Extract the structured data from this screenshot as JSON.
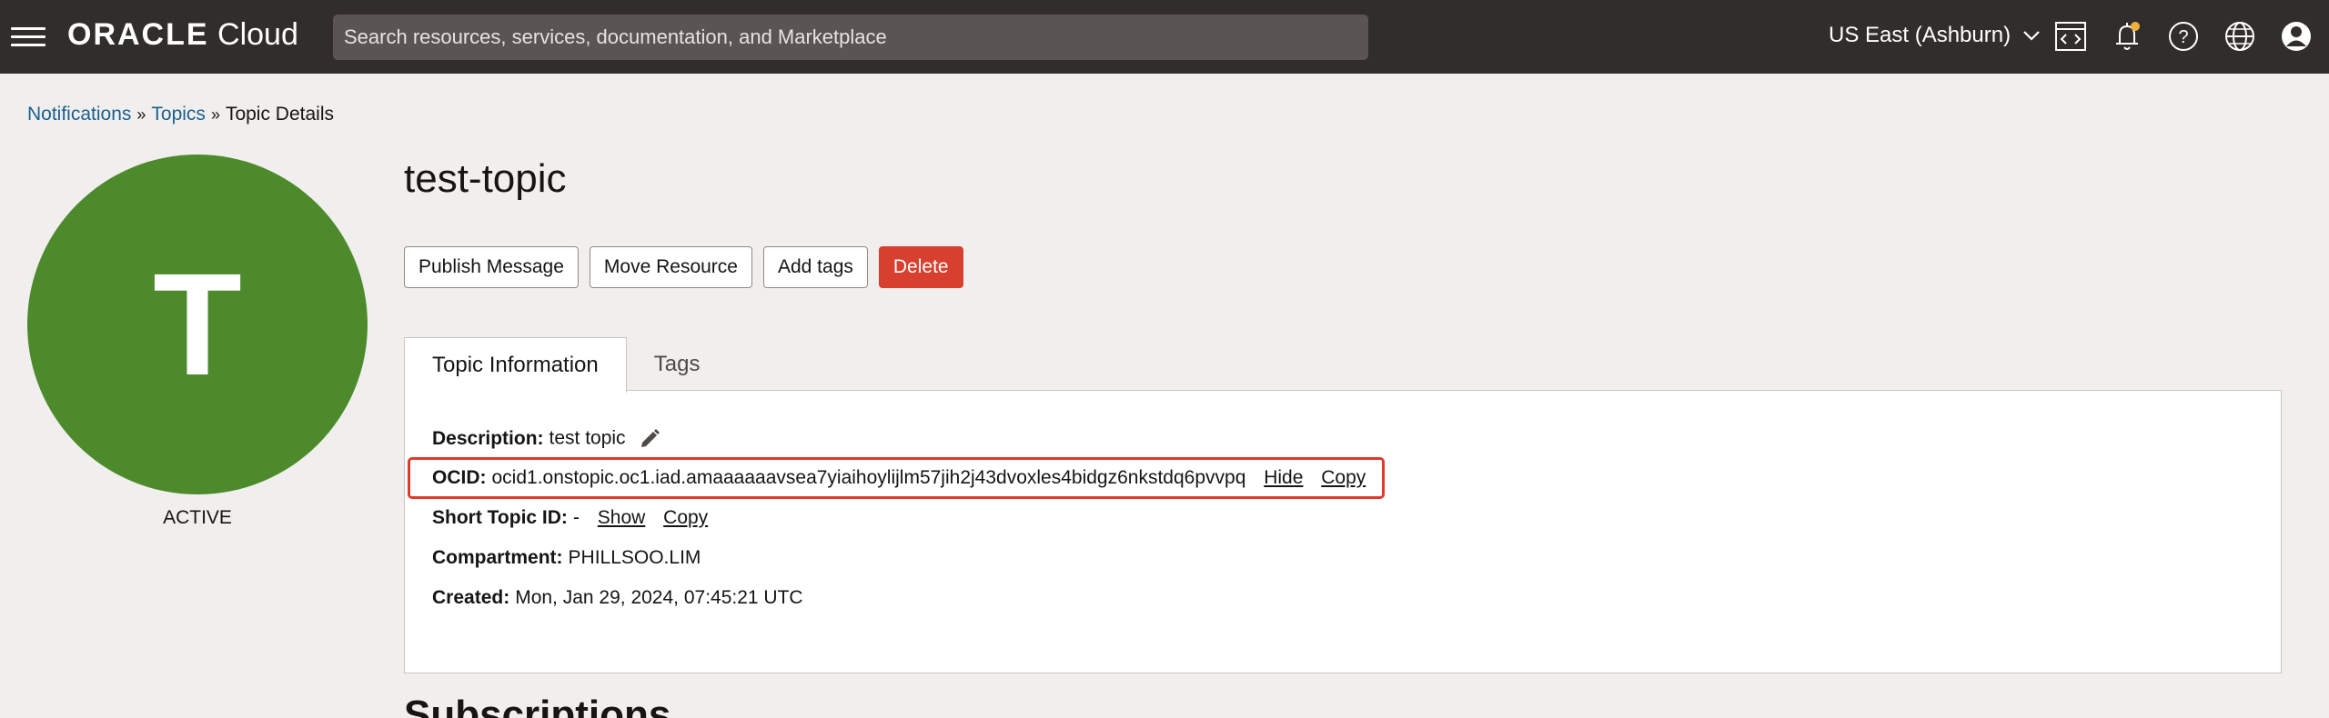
{
  "topbar": {
    "brand_bold": "ORACLE",
    "brand_light": "Cloud",
    "search_placeholder": "Search resources, services, documentation, and Marketplace",
    "region": "US East (Ashburn)",
    "icons": [
      "hamburger-menu-icon",
      "cloud-shell-icon",
      "notification-bell-icon",
      "help-icon",
      "language-globe-icon",
      "user-profile-icon"
    ]
  },
  "breadcrumb": {
    "items": [
      "Notifications",
      "Topics"
    ],
    "current": "Topic Details",
    "separator": "»"
  },
  "resource": {
    "avatar_letter": "T",
    "avatar_color": "#4d8a2c",
    "state": "ACTIVE",
    "title": "test-topic"
  },
  "actions": {
    "publish": "Publish Message",
    "move": "Move Resource",
    "add_tags": "Add tags",
    "delete": "Delete"
  },
  "tabs": {
    "info": "Topic Information",
    "tags": "Tags"
  },
  "details": {
    "description_label": "Description:",
    "description_value": "test topic",
    "ocid_label": "OCID:",
    "ocid_value": "ocid1.onstopic.oc1.iad.amaaaaaavsea7yiaihoylijlm57jih2j43dvoxles4bidgz6nkstdq6pvvpq",
    "ocid_hide": "Hide",
    "ocid_copy": "Copy",
    "short_id_label": "Short Topic ID:",
    "short_id_value": "-",
    "short_id_show": "Show",
    "short_id_copy": "Copy",
    "compartment_label": "Compartment:",
    "compartment_value": "PHILLSOO.LIM",
    "created_label": "Created:",
    "created_value": "Mon, Jan 29, 2024, 07:45:21 UTC"
  },
  "sections": {
    "subscriptions": "Subscriptions"
  },
  "colors": {
    "topbar": "#312d2a",
    "link": "#1b5f8f",
    "danger": "#d73f2e",
    "highlight": "#e03a2c"
  }
}
